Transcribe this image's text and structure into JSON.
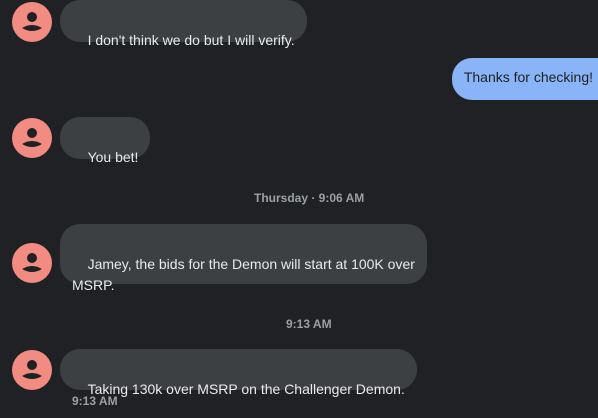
{
  "messages": [
    {
      "sender": "contact",
      "text": "I don't think we do but I will verify."
    },
    {
      "sender": "me",
      "text": "Thanks for checking!"
    },
    {
      "sender": "contact",
      "text": "You bet!"
    },
    {
      "sender": "contact",
      "text": "Jamey, the bids for the Demon will start at 100K over MSRP."
    },
    {
      "sender": "contact",
      "text": "Taking 130k over MSRP on the Challenger Demon."
    }
  ],
  "separators": [
    {
      "text": "Thursday · 9:06 AM"
    },
    {
      "text": "9:13 AM"
    }
  ],
  "last_message_time": "9:13 AM",
  "colors": {
    "background": "#202124",
    "incoming_bubble": "#3c4043",
    "outgoing_bubble": "#8ab4f8",
    "avatar": "#f28b82",
    "timestamp_text": "#9aa0a6"
  },
  "icons": {
    "avatar": "person-icon"
  }
}
